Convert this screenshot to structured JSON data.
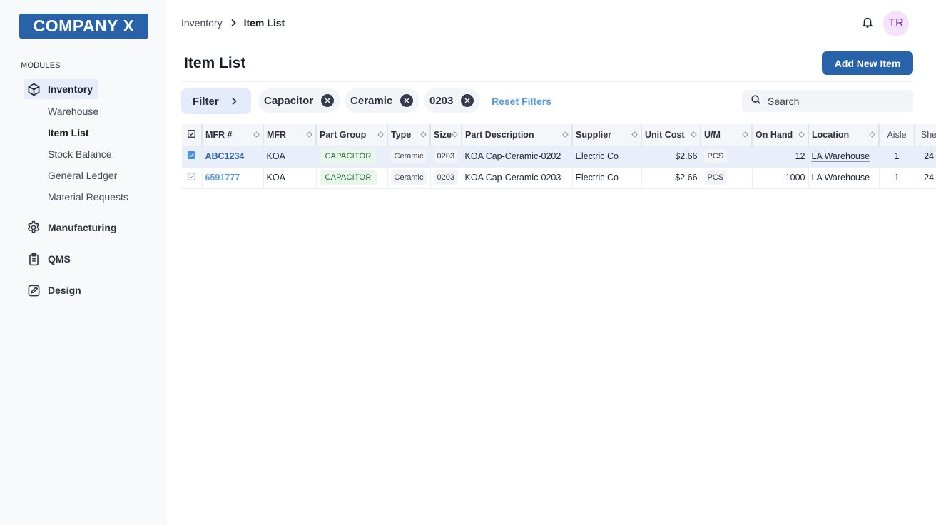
{
  "sidebar": {
    "logo": "COMPANY X",
    "modules_label": "MODULES",
    "modules": [
      {
        "label": "Inventory",
        "icon": "cube-icon",
        "active": true
      },
      {
        "label": "Manufacturing",
        "icon": "gear-icon"
      },
      {
        "label": "QMS",
        "icon": "clipboard-icon"
      },
      {
        "label": "Design",
        "icon": "edit-icon"
      }
    ],
    "inventory_subitems": [
      {
        "label": "Warehouse"
      },
      {
        "label": "Item List",
        "current": true
      },
      {
        "label": "Stock Balance"
      },
      {
        "label": "General Ledger"
      },
      {
        "label": "Material Requests"
      }
    ]
  },
  "header": {
    "breadcrumb": [
      "Inventory",
      "Item List"
    ],
    "avatar_initials": "TR",
    "bell_icon": "bell-icon"
  },
  "page": {
    "title": "Item List",
    "add_button": "Add New Item"
  },
  "filters": {
    "filter_button": "Filter",
    "chips": [
      "Capacitor",
      "Ceramic",
      "0203"
    ],
    "reset_label": "Reset Filters",
    "search_placeholder": "Search"
  },
  "colors": {
    "brand": "#2862a8",
    "link": "#5b9be0",
    "selected_row": "#e9eefb",
    "avatar_bg": "#f4e3fb",
    "avatar_text": "#6b1d9a"
  },
  "table": {
    "columns": [
      "MFR #",
      "MFR",
      "Part Group",
      "Type",
      "Size",
      "Part Description",
      "Supplier",
      "Unit Cost",
      "U/M",
      "On Hand",
      "Location",
      "Aisle",
      "Shelf"
    ],
    "column_labels_visible": [
      "MFR #",
      "MFR",
      "Part Group",
      "Type",
      "Size",
      "Part Description",
      "Supplier",
      "Unit Cost",
      "U/M",
      "On Hand",
      "Location",
      "Aisle",
      "She"
    ],
    "rows": [
      {
        "selected": true,
        "mfr_no": "ABC1234",
        "mfr": "KOA",
        "part_group": "CAPACITOR",
        "type": "Ceramic",
        "size": "0203",
        "description": "KOA Cap-Ceramic-0202",
        "supplier": "Electric Co",
        "unit_cost": "$2.66",
        "um": "PCS",
        "on_hand": "12",
        "location": "LA Warehouse",
        "aisle": "1",
        "shelf": "24"
      },
      {
        "selected": false,
        "mfr_no": "6591777",
        "mfr": "KOA",
        "part_group": "CAPACITOR",
        "type": "Ceramic",
        "size": "0203",
        "description": "KOA Cap-Ceramic-0203",
        "supplier": "Electric Co",
        "unit_cost": "$2.66",
        "um": "PCS",
        "on_hand": "1000",
        "location": "LA Warehouse",
        "aisle": "1",
        "shelf": "24"
      }
    ]
  }
}
